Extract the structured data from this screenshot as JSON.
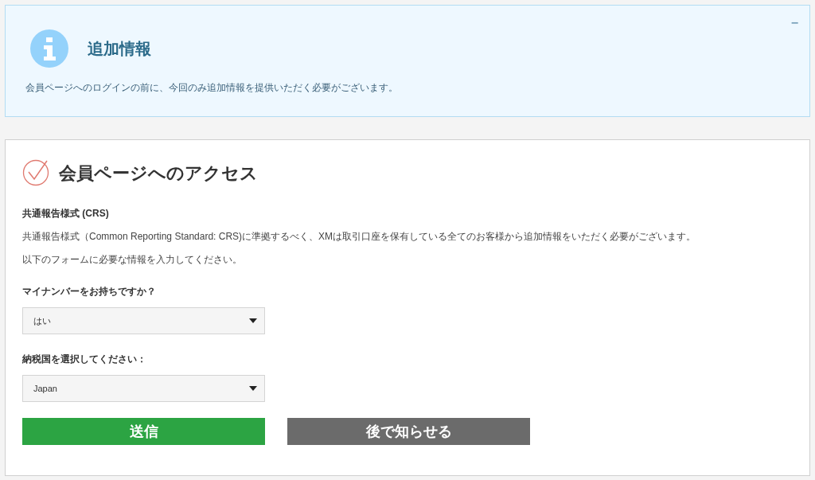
{
  "info_panel": {
    "title": "追加情報",
    "message": "会員ページへのログインの前に、今回のみ追加情報を提供いただく必要がございます。",
    "collapse_button": "−"
  },
  "access_form": {
    "title": "会員ページへのアクセス",
    "section_heading": "共通報告様式 (CRS)",
    "paragraphs": [
      "共通報告様式（Common Reporting Standard: CRS)に準拠するべく、XMは取引口座を保有している全てのお客様から追加情報をいただく必要がございます。",
      "以下のフォームに必要な情報を入力してください。"
    ],
    "fields": [
      {
        "label": "マイナンバーをお持ちですか？",
        "value": "はい"
      },
      {
        "label": "納税国を選択してください：",
        "value": "Japan"
      }
    ],
    "buttons": [
      {
        "label": "送信",
        "kind": "primary"
      },
      {
        "label": "後で知らせる",
        "kind": "secondary"
      }
    ]
  }
}
